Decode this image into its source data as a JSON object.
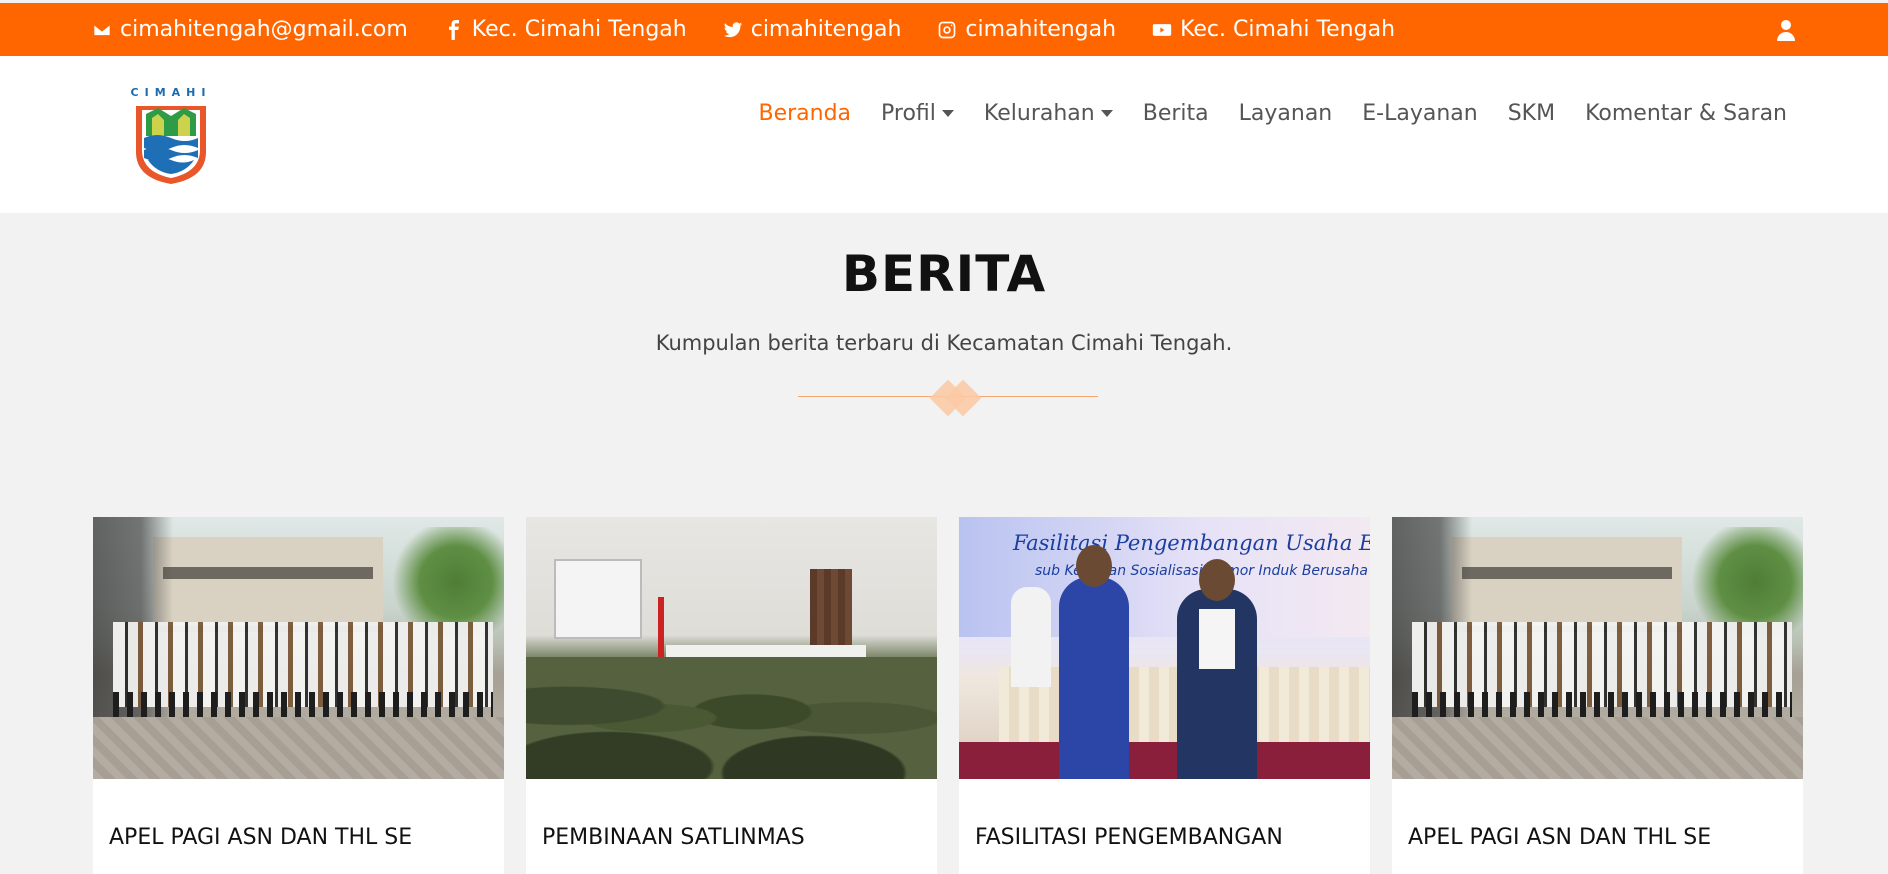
{
  "topbar": {
    "email": "cimahitengah@gmail.com",
    "facebook": "Kec. Cimahi Tengah",
    "twitter": "cimahitengah",
    "instagram": "cimahitengah",
    "youtube": "Kec. Cimahi Tengah",
    "icons": [
      "envelope-icon",
      "facebook-icon",
      "twitter-icon",
      "instagram-icon",
      "youtube-icon",
      "user-icon"
    ],
    "color": "#ff6600"
  },
  "logo": {
    "text": "CIMAHI"
  },
  "nav": {
    "items": [
      {
        "label": "Beranda",
        "active": true
      },
      {
        "label": "Profil",
        "dropdown": true
      },
      {
        "label": "Kelurahan",
        "dropdown": true
      },
      {
        "label": "Berita"
      },
      {
        "label": "Layanan"
      },
      {
        "label": "E-Layanan"
      },
      {
        "label": "SKM"
      },
      {
        "label": "Komentar & Saran"
      }
    ],
    "active_color": "#ff6600"
  },
  "section": {
    "title": "BERITA",
    "subtitle": "Kumpulan berita terbaru di Kecamatan Cimahi Tengah."
  },
  "cards": [
    {
      "title": "APEL PAGI ASN DAN THL SE",
      "image": "apel"
    },
    {
      "title": "PEMBINAAN SATLINMAS",
      "image": "meeting"
    },
    {
      "title": "FASILITASI PENGEMBANGAN",
      "image": "fasilitasi",
      "banner_title": "Fasilitasi Pengembangan Usaha Ekonomi Masyar",
      "banner_sub": "sub Kegiatan Sosialisasi Nomor Induk Berusaha (NIB)"
    },
    {
      "title": "APEL PAGI ASN DAN THL SE",
      "image": "apel"
    }
  ]
}
